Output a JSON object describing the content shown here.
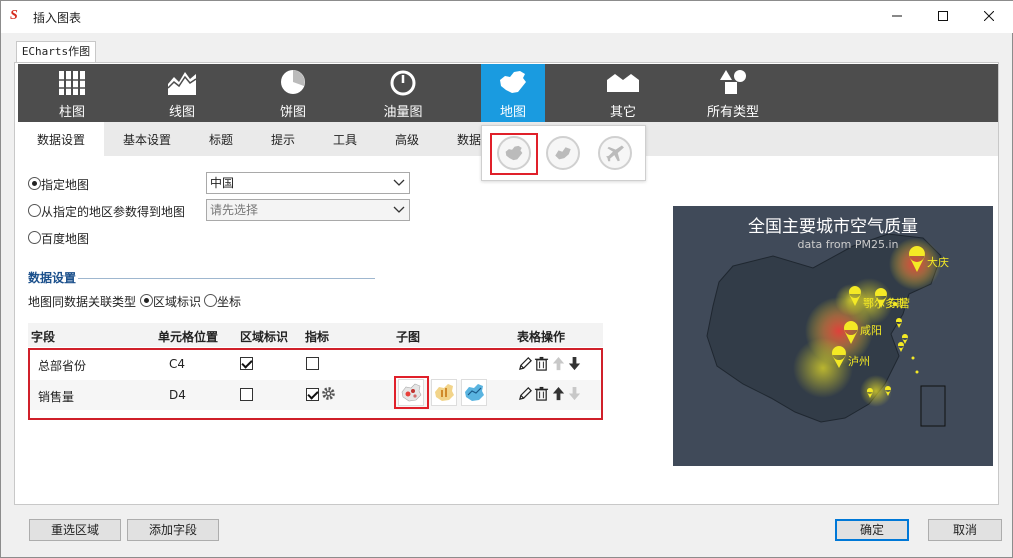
{
  "window": {
    "title": "插入图表",
    "app_icon_glyph": "S"
  },
  "outer_tab": {
    "label": "ECharts作图"
  },
  "chart_types": [
    {
      "label": "柱图",
      "icon": "bar-chart-icon"
    },
    {
      "label": "线图",
      "icon": "line-chart-icon"
    },
    {
      "label": "饼图",
      "icon": "pie-chart-icon"
    },
    {
      "label": "油量图",
      "icon": "gauge-icon"
    },
    {
      "label": "地图",
      "icon": "map-china-icon",
      "selected": true
    },
    {
      "label": "其它",
      "icon": "other-chart-icon"
    },
    {
      "label": "所有类型",
      "icon": "all-types-icon"
    }
  ],
  "settings_tabs": [
    "数据设置",
    "基本设置",
    "标题",
    "提示",
    "工具",
    "高级",
    "数据"
  ],
  "map_subtypes": [
    "china-map-icon",
    "province-map-icon",
    "flight-map-icon"
  ],
  "map_source": {
    "opt_specified": "指定地图",
    "opt_param": "从指定的地区参数得到地图",
    "opt_baidu": "百度地图",
    "specified_value": "中国",
    "param_placeholder": "请先选择"
  },
  "data_settings": {
    "heading": "数据设置",
    "assoc_label": "地图同数据关联类型",
    "assoc_region": "区域标识",
    "assoc_coord": "坐标"
  },
  "grid": {
    "columns": [
      "字段",
      "单元格位置",
      "区域标识",
      "指标",
      "子图",
      "表格操作"
    ],
    "rows": [
      {
        "field": "总部省份",
        "cell": "C4",
        "region": true,
        "metric": false
      },
      {
        "field": "销售量",
        "cell": "D4",
        "region": false,
        "metric": true
      }
    ]
  },
  "preview": {
    "title": "全国主要城市空气质量",
    "subtitle": "data from PM25.in",
    "cities": [
      "大庆",
      "鄂尔多斯",
      "咸阳",
      "泸州"
    ],
    "extra_label": "东营",
    "colors": {
      "bg": "#404a59",
      "land": "#323c48",
      "point": "#f4e925",
      "hot": "#e8403a"
    }
  },
  "buttons": {
    "reselect": "重选区域",
    "add_field": "添加字段",
    "ok": "确定",
    "cancel": "取消"
  }
}
